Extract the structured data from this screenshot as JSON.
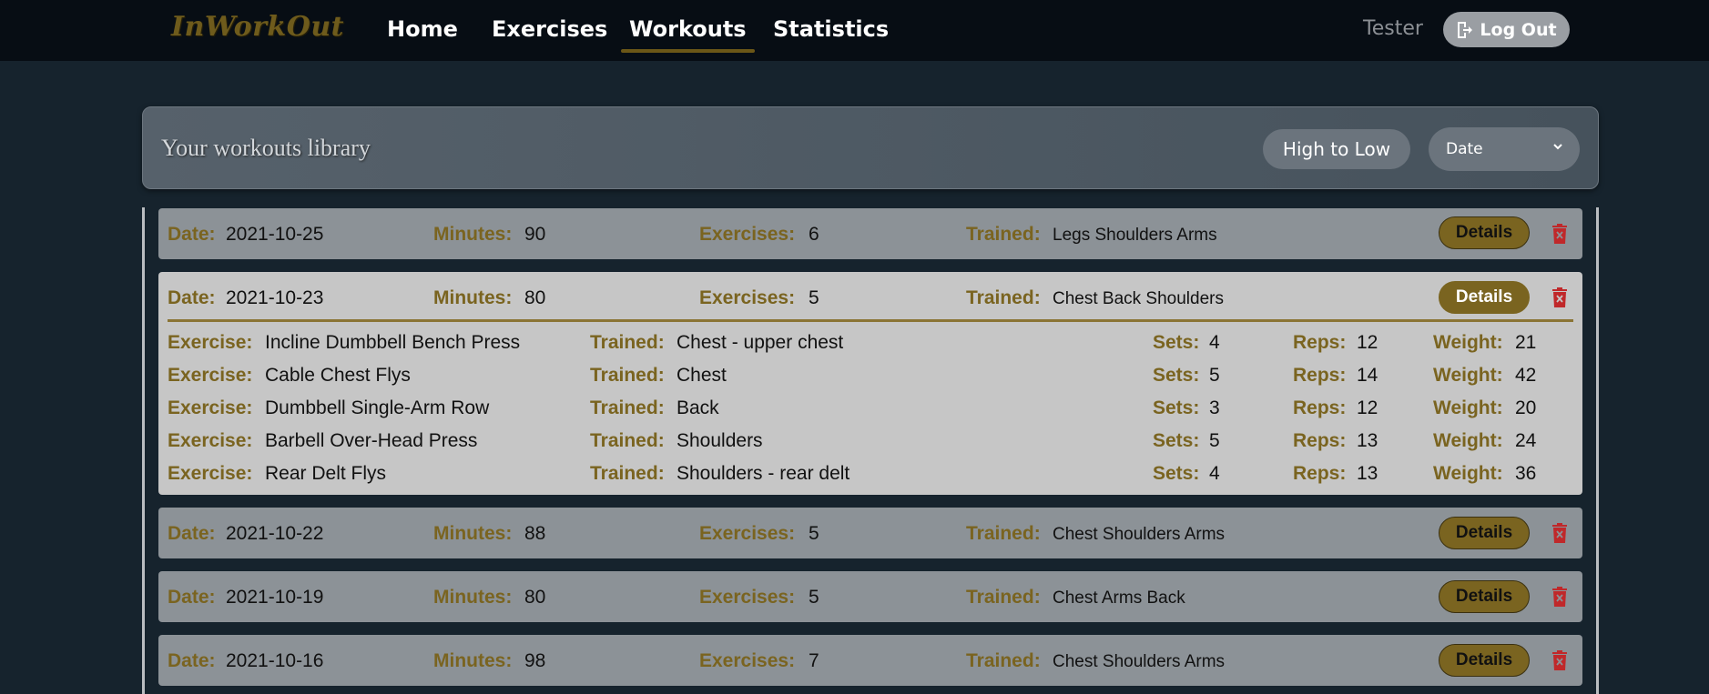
{
  "nav": {
    "logo": "InWorkOut",
    "links": [
      "Home",
      "Exercises",
      "Workouts",
      "Statistics"
    ],
    "active": "Workouts",
    "user": "Tester",
    "logout_label": "Log Out"
  },
  "library": {
    "title": "Your workouts library",
    "sort_order_label": "High to Low",
    "sort_by_value": "Date"
  },
  "labels": {
    "date": "Date:",
    "minutes": "Minutes:",
    "exercises": "Exercises:",
    "trained": "Trained:",
    "exercise": "Exercise:",
    "sets": "Sets:",
    "reps": "Reps:",
    "weight": "Weight:",
    "details": "Details"
  },
  "workouts": [
    {
      "date": "2021-10-25",
      "minutes": "90",
      "exercises": "6",
      "trained": "Legs Shoulders Arms"
    },
    {
      "date": "2021-10-23",
      "minutes": "80",
      "exercises": "5",
      "trained": "Chest Back Shoulders",
      "details": [
        {
          "exercise": "Incline Dumbbell Bench Press",
          "trained": "Chest - upper chest",
          "sets": "4",
          "reps": "12",
          "weight": "21"
        },
        {
          "exercise": "Cable Chest Flys",
          "trained": "Chest",
          "sets": "5",
          "reps": "14",
          "weight": "42"
        },
        {
          "exercise": "Dumbbell Single-Arm Row",
          "trained": "Back",
          "sets": "3",
          "reps": "12",
          "weight": "20"
        },
        {
          "exercise": "Barbell Over-Head Press",
          "trained": "Shoulders",
          "sets": "5",
          "reps": "13",
          "weight": "24"
        },
        {
          "exercise": "Rear Delt Flys",
          "trained": "Shoulders - rear delt",
          "sets": "4",
          "reps": "13",
          "weight": "36"
        }
      ]
    },
    {
      "date": "2021-10-22",
      "minutes": "88",
      "exercises": "5",
      "trained": "Chest Shoulders Arms"
    },
    {
      "date": "2021-10-19",
      "minutes": "80",
      "exercises": "5",
      "trained": "Chest Arms Back"
    },
    {
      "date": "2021-10-16",
      "minutes": "98",
      "exercises": "7",
      "trained": "Chest Shoulders Arms"
    }
  ],
  "icons": {
    "logout": "logout-icon",
    "delete": "trash-icon",
    "dropdown": "chevron-down-icon"
  },
  "colors": {
    "accent": "#7a6420",
    "navbar": "#070d14",
    "background": "#16232d",
    "delete": "#c0282a"
  }
}
